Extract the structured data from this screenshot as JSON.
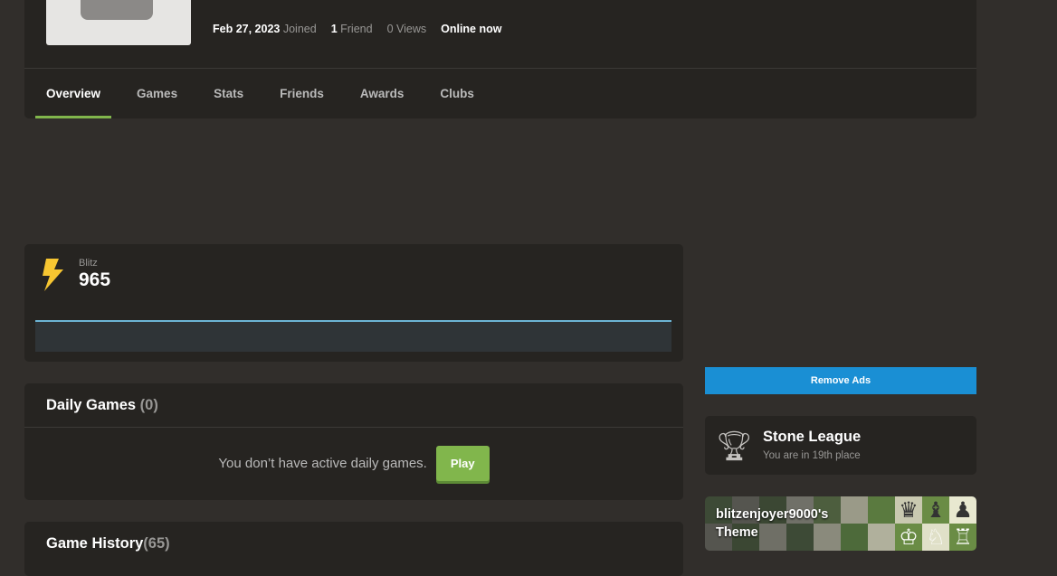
{
  "profile": {
    "joined_date": "Feb 27, 2023",
    "joined_label": "Joined",
    "friends_count": "1",
    "friends_label": "Friend",
    "views": "0 Views",
    "status": "Online now"
  },
  "tabs": [
    "Overview",
    "Games",
    "Stats",
    "Friends",
    "Awards",
    "Clubs"
  ],
  "rating": {
    "label": "Blitz",
    "value": "965",
    "icon": "lightning-icon"
  },
  "remove_ads": "Remove Ads",
  "daily": {
    "title": "Daily Games",
    "count": "(0)",
    "empty": "You don’t have active daily games.",
    "play": "Play"
  },
  "league": {
    "title": "Stone League",
    "subtitle": "You are in 19th place"
  },
  "theme": {
    "line1": "blitzenjoyer9000's",
    "line2": "Theme"
  },
  "history": {
    "title": "Game History",
    "count": "(65)"
  },
  "colors": {
    "accent": "#81b64c",
    "ads": "#1a8fd4"
  }
}
